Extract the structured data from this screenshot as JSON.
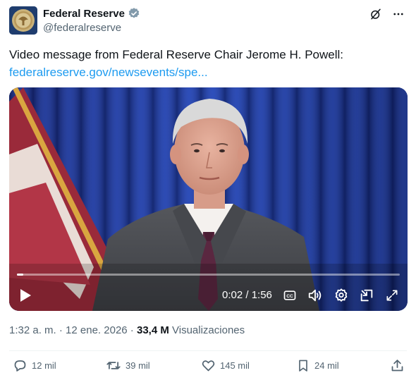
{
  "account": {
    "name": "Federal Reserve",
    "handle": "@federalreserve",
    "avatar_icon": "federal-reserve-seal-icon",
    "verified_icon": "verified-badge-icon"
  },
  "header_icons": [
    "grok-icon",
    "more-options-icon"
  ],
  "tweet": {
    "text": "Video message from Federal Reserve Chair Jerome H. Powell:",
    "link": "federalreserve.gov/newsevents/spe..."
  },
  "video": {
    "time_display": "0:02 / 1:56",
    "progress_fraction": 0.017,
    "controls": [
      "play-icon",
      "captions-icon",
      "volume-icon",
      "settings-icon",
      "pip-icon",
      "fullscreen-icon"
    ]
  },
  "meta": {
    "time": "1:32 a. m.",
    "separator1": " · ",
    "date": "12 ene. 2026",
    "separator2": " · ",
    "views_count": "33,4 M",
    "views_label": "Visualizaciones"
  },
  "actions": {
    "replies": "12 mil",
    "reposts": "39 mil",
    "likes": "145 mil",
    "bookmarks": "24 mil"
  },
  "colors": {
    "link": "#1d9bf0",
    "secondary_text": "#536471",
    "verified": "#829aab"
  }
}
